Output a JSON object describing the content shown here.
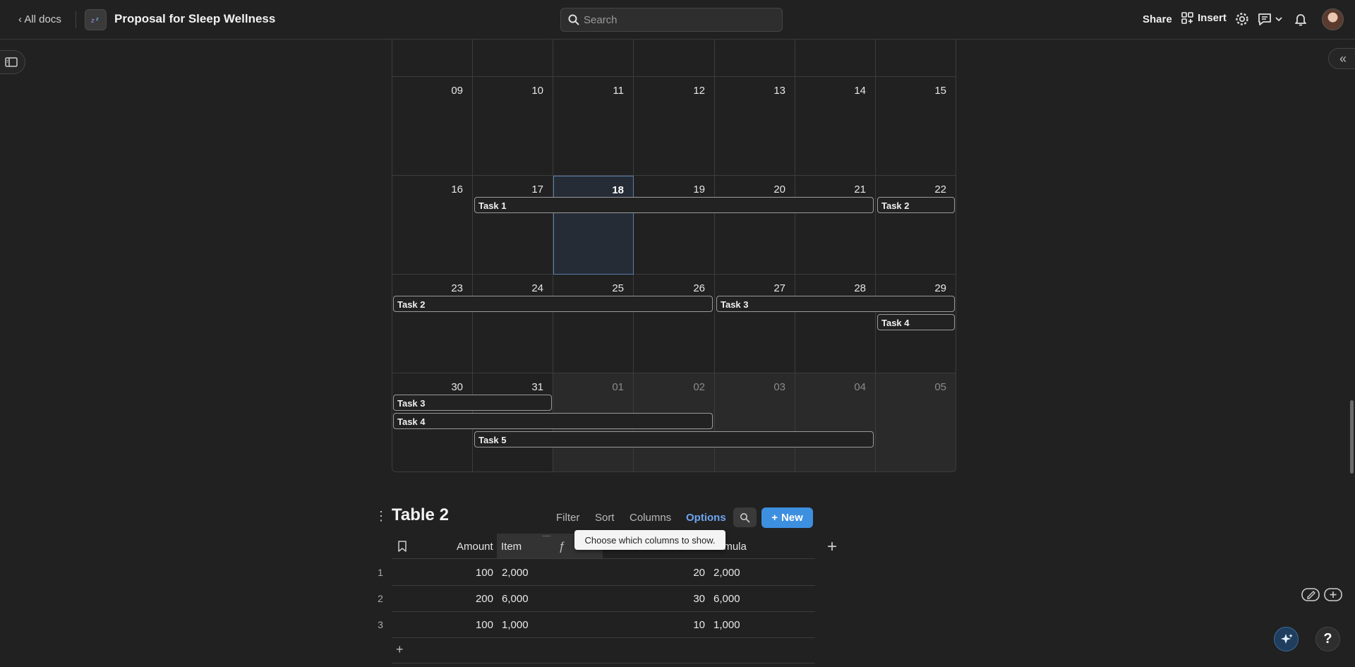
{
  "header": {
    "back_label": "All docs",
    "doc_title": "Proposal for Sleep Wellness",
    "search_placeholder": "Search",
    "share_label": "Share",
    "insert_label": "Insert"
  },
  "calendar": {
    "rows": [
      {
        "days": [
          "09",
          "10",
          "11",
          "12",
          "13",
          "14",
          "15"
        ]
      },
      {
        "days": [
          "16",
          "17",
          "18",
          "19",
          "20",
          "21",
          "22"
        ]
      },
      {
        "days": [
          "23",
          "24",
          "25",
          "26",
          "27",
          "28",
          "29"
        ]
      },
      {
        "days": [
          "30",
          "31",
          "01",
          "02",
          "03",
          "04",
          "05"
        ]
      }
    ],
    "today": "18",
    "tasks": {
      "t1": "Task 1",
      "t2a": "Task 2",
      "t2b": "Task 2",
      "t3a": "Task 3",
      "t4a": "Task 4",
      "t3b": "Task 3",
      "t4b": "Task 4",
      "t5": "Task 5"
    }
  },
  "table": {
    "title": "Table 2",
    "actions": {
      "filter": "Filter",
      "sort": "Sort",
      "columns": "Columns",
      "options": "Options",
      "new": "New"
    },
    "columns": {
      "amount": "Amount",
      "item": "Item",
      "formula": "ormula"
    },
    "tooltip": "Choose which columns to show.",
    "rows": [
      {
        "num": "1",
        "amount": "100",
        "item": "2,000",
        "qty": "20",
        "formula": "2,000"
      },
      {
        "num": "2",
        "amount": "200",
        "item": "6,000",
        "qty": "30",
        "formula": "6,000"
      },
      {
        "num": "3",
        "amount": "100",
        "item": "1,000",
        "qty": "10",
        "formula": "1,000"
      }
    ]
  },
  "colors": {
    "background": "#212121",
    "accent": "#3d8fe0",
    "options_link": "#6ca6f0"
  }
}
